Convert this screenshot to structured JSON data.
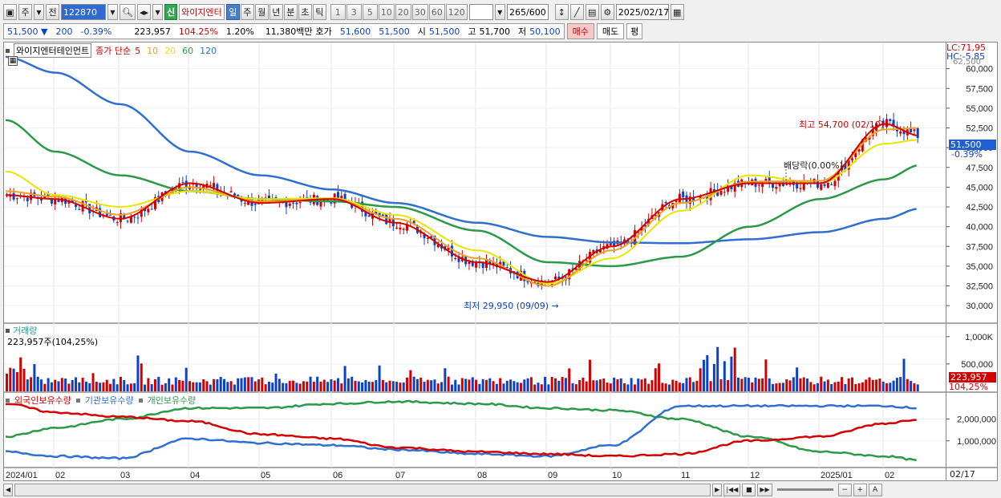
{
  "toolbar": {
    "period_tab": "주",
    "prev_label": "전",
    "stock_code": "122870",
    "shin_label": "신",
    "stock_name": "와이지엔터",
    "period_buttons": [
      "일",
      "주",
      "월",
      "년",
      "분",
      "초",
      "틱"
    ],
    "minute_buttons": [
      "1",
      "3",
      "5",
      "10",
      "20",
      "30",
      "60",
      "120"
    ],
    "count_display": "265",
    "count_total": "/600",
    "date": "2025/02/17"
  },
  "quote": {
    "price": "51,500",
    "change_arrow": "▼",
    "change": "200",
    "change_pct": "-0.39%",
    "volume": "223,957",
    "volume_ratio": "104.25%",
    "turnover_pct": "1.20%",
    "amount": "11,380백만",
    "bid_label": "호가",
    "bid1": "51,600",
    "bid2": "51,500",
    "open_label": "시",
    "open": "51,500",
    "high_label": "고",
    "high": "51,700",
    "low_label": "저",
    "low": "50,100",
    "buy_label": "매수",
    "sell_label": "매도",
    "eval_label": "평"
  },
  "legend": {
    "stock": "와이지엔터테인먼트",
    "ma_prefix": "종가 단순",
    "ma_items": [
      {
        "label": "5",
        "color": "#d40000"
      },
      {
        "label": "10",
        "color": "#f0a020"
      },
      {
        "label": "20",
        "color": "#e6e600"
      },
      {
        "label": "60",
        "color": "#2a9a4a"
      },
      {
        "label": "120",
        "color": "#2e6fd0"
      }
    ]
  },
  "price_panel": {
    "lc": "LC:71,95",
    "hc": "HC:-5,85",
    "axis_top_partial": "62,500",
    "y_ticks": [
      "60,000",
      "57,500",
      "55,000",
      "52,500",
      "50,000",
      "47,500",
      "45,000",
      "42,500",
      "40,000",
      "37,500",
      "35,000",
      "32,500",
      "30,000"
    ],
    "current_price_tag": "51,500",
    "current_pct_tag": "-0.39%",
    "high_annotation": "최고 54,700 (02/10)",
    "low_annotation": "최저 29,950 (09/09)",
    "dividend_annotation": "배당락(0.00%)"
  },
  "volume_panel": {
    "title": "거래량",
    "value_text": "223,957주(104,25%)",
    "y_ticks": [
      "1,000K",
      "500,000"
    ],
    "current_tag": "223,957",
    "current_pct_tag": "104,25%"
  },
  "holding_panel": {
    "legend": [
      {
        "label": "외국인보유수량",
        "color": "#d40000"
      },
      {
        "label": "기관보유수량",
        "color": "#2e6fd0"
      },
      {
        "label": "개인보유수량",
        "color": "#2a9a4a"
      }
    ],
    "y_ticks": [
      "2,000,000",
      "1,000,000"
    ]
  },
  "x_axis": {
    "labels": [
      "2024/01",
      "02",
      "03",
      "04",
      "05",
      "06",
      "07",
      "08",
      "09",
      "10",
      "11",
      "12",
      "2025/01",
      "02"
    ],
    "right_label": "02/17"
  },
  "colors": {
    "up": "#d40000",
    "down": "#0b42c8",
    "ma5": "#d40000",
    "ma10": "#f0a020",
    "ma20": "#e6e600",
    "ma60": "#2a9a4a",
    "ma120": "#2e6fd0"
  },
  "chart_data": {
    "type": "line",
    "x": [
      "2024/01",
      "02",
      "03",
      "04",
      "05",
      "06",
      "07",
      "08",
      "09",
      "10",
      "11",
      "12",
      "2025/01",
      "02",
      "02/17"
    ],
    "series": [
      {
        "name": "5",
        "values": [
          44000,
          43500,
          41000,
          45500,
          43000,
          43500,
          40500,
          35500,
          33000,
          37500,
          43500,
          45500,
          45500,
          53000,
          51500
        ]
      },
      {
        "name": "10",
        "values": [
          44500,
          43800,
          41500,
          45000,
          43200,
          43500,
          41000,
          36000,
          32500,
          37000,
          43000,
          45700,
          45800,
          52300,
          52500
        ]
      },
      {
        "name": "20",
        "values": [
          47000,
          44000,
          42500,
          44500,
          43500,
          43600,
          41500,
          37000,
          32800,
          36000,
          42000,
          46500,
          45500,
          50500,
          51000
        ]
      },
      {
        "name": "60",
        "values": [
          53500,
          49500,
          46500,
          44500,
          43500,
          43200,
          42500,
          39500,
          35500,
          35000,
          36200,
          40000,
          43500,
          46000,
          47800
        ]
      },
      {
        "name": "120",
        "values": [
          61500,
          59500,
          55500,
          49500,
          46500,
          44700,
          43000,
          40500,
          38700,
          38000,
          37900,
          38400,
          39300,
          41000,
          42300
        ]
      }
    ],
    "ylim": [
      29000,
      62500
    ]
  }
}
